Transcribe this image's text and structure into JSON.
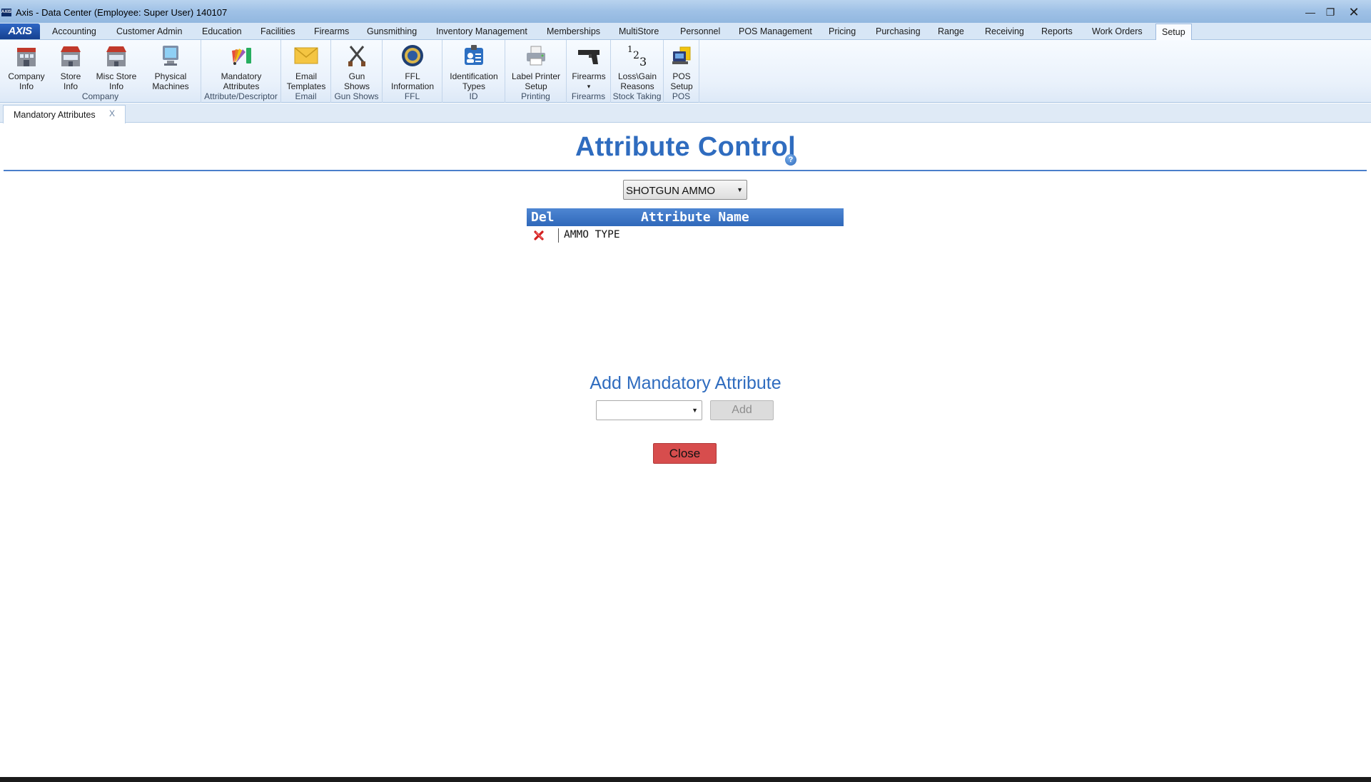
{
  "window": {
    "title": "Axis - Data Center  (Employee: Super User) 140107",
    "app_icon_text": "AXIS"
  },
  "menu": {
    "logo": "AXIS",
    "tabs": [
      {
        "label": "Accounting"
      },
      {
        "label": "Customer Admin"
      },
      {
        "label": "Education"
      },
      {
        "label": "Facilities"
      },
      {
        "label": "Firearms"
      },
      {
        "label": "Gunsmithing"
      },
      {
        "label": "Inventory Management"
      },
      {
        "label": "Memberships"
      },
      {
        "label": "MultiStore"
      },
      {
        "label": "Personnel"
      },
      {
        "label": "POS Management"
      },
      {
        "label": "Pricing"
      },
      {
        "label": "Purchasing"
      },
      {
        "label": "Range"
      },
      {
        "label": "Receiving"
      },
      {
        "label": "Reports"
      },
      {
        "label": "Work Orders"
      },
      {
        "label": "Setup"
      }
    ],
    "active_tab": "Setup"
  },
  "ribbon": {
    "groups": [
      {
        "label": "Company",
        "buttons": [
          {
            "line1": "Company",
            "line2": "Info",
            "icon": "building-icon"
          },
          {
            "line1": "Store",
            "line2": "Info",
            "icon": "store-icon"
          },
          {
            "line1": "Misc Store",
            "line2": "Info",
            "icon": "store-icon"
          },
          {
            "line1": "Physical",
            "line2": "Machines",
            "icon": "monitor-icon"
          }
        ]
      },
      {
        "label": "Attribute/Descriptor",
        "buttons": [
          {
            "line1": "Mandatory",
            "line2": "Attributes",
            "icon": "color-fan-icon"
          }
        ]
      },
      {
        "label": "Email",
        "buttons": [
          {
            "line1": "Email",
            "line2": "Templates",
            "icon": "envelope-icon"
          }
        ]
      },
      {
        "label": "Gun Shows",
        "buttons": [
          {
            "line1": "Gun",
            "line2": "Shows",
            "icon": "crossed-guns-icon"
          }
        ]
      },
      {
        "label": "FFL",
        "buttons": [
          {
            "line1": "FFL",
            "line2": "Information",
            "icon": "seal-icon"
          }
        ]
      },
      {
        "label": "ID",
        "buttons": [
          {
            "line1": "Identification",
            "line2": "Types",
            "icon": "id-badge-icon"
          }
        ]
      },
      {
        "label": "Printing",
        "buttons": [
          {
            "line1": "Label Printer",
            "line2": "Setup",
            "icon": "printer-icon"
          }
        ]
      },
      {
        "label": "Firearms",
        "buttons": [
          {
            "line1": "Firearms",
            "line2": "▾",
            "icon": "pistol-icon"
          }
        ]
      },
      {
        "label": "Stock Taking",
        "buttons": [
          {
            "line1": "Loss\\Gain",
            "line2": "Reasons",
            "icon": "numbers-123-icon"
          }
        ]
      },
      {
        "label": "POS",
        "buttons": [
          {
            "line1": "POS",
            "line2": "Setup",
            "icon": "pos-terminal-icon"
          }
        ]
      }
    ]
  },
  "doc_tabs": [
    {
      "label": "Mandatory Attributes",
      "close": "X"
    }
  ],
  "content": {
    "title": "Attribute Control",
    "help_icon": "?",
    "category_select": {
      "value": "SHOTGUN AMMO"
    },
    "grid": {
      "headers": {
        "del": "Del",
        "name": "Attribute Name"
      },
      "rows": [
        {
          "name": "AMMO TYPE"
        }
      ]
    },
    "add_section": {
      "title": "Add Mandatory Attribute",
      "select_value": "",
      "add_label": "Add"
    },
    "close_label": "Close"
  },
  "colors": {
    "accent": "#2f6cbf",
    "grid_header": "#3b74c6",
    "close_button": "#d74d4d",
    "add_disabled": "#dcdcdc"
  }
}
